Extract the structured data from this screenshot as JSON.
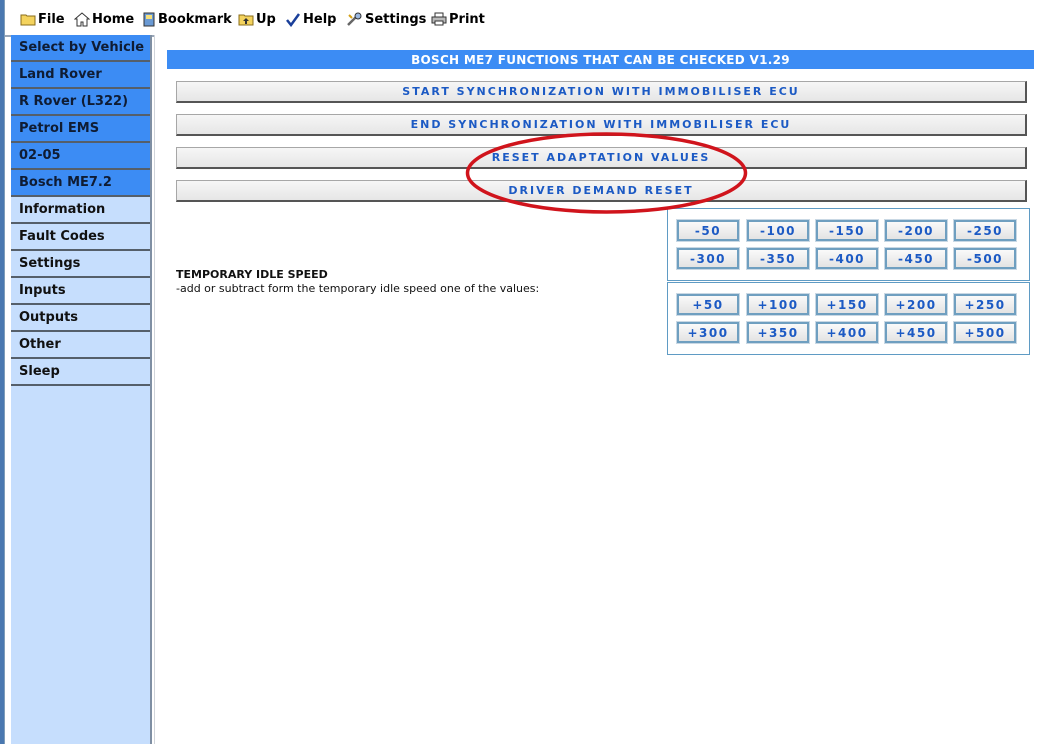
{
  "toolbar": {
    "items": [
      {
        "label": "File",
        "icon": "folder-icon"
      },
      {
        "label": "Home",
        "icon": "home-icon"
      },
      {
        "label": "Bookmark",
        "icon": "bookmark-icon"
      },
      {
        "label": "Up",
        "icon": "up-folder-icon"
      },
      {
        "label": "Help",
        "icon": "help-icon"
      },
      {
        "label": "Settings",
        "icon": "settings-icon"
      },
      {
        "label": "Print",
        "icon": "printer-icon"
      }
    ]
  },
  "sidebar": {
    "items": [
      {
        "label": "Select by Vehicle",
        "style": "blue"
      },
      {
        "label": "Land Rover",
        "style": "blue"
      },
      {
        "label": "R Rover (L322)",
        "style": "blue"
      },
      {
        "label": "Petrol EMS",
        "style": "blue"
      },
      {
        "label": "02-05",
        "style": "blue"
      },
      {
        "label": "Bosch ME7.2",
        "style": "blue"
      },
      {
        "label": "Information",
        "style": "light"
      },
      {
        "label": "Fault Codes",
        "style": "light"
      },
      {
        "label": "Settings",
        "style": "light"
      },
      {
        "label": "Inputs",
        "style": "light"
      },
      {
        "label": "Outputs",
        "style": "light"
      },
      {
        "label": "Other",
        "style": "light"
      },
      {
        "label": "Sleep",
        "style": "light"
      }
    ]
  },
  "main": {
    "banner": "BOSCH ME7 FUNCTIONS THAT CAN BE CHECKED V1.29",
    "functions": [
      "START SYNCHRONIZATION WITH IMMOBILISER ECU",
      "END SYNCHRONIZATION WITH IMMOBILISER ECU",
      "RESET ADAPTATION VALUES",
      "DRIVER DEMAND RESET"
    ],
    "idle": {
      "title": "TEMPORARY IDLE SPEED",
      "description": "-add or subtract form the temporary idle speed one of the values:",
      "minus": [
        "-50",
        "-100",
        "-150",
        "-200",
        "-250",
        "-300",
        "-350",
        "-400",
        "-450",
        "-500"
      ],
      "plus": [
        "+50",
        "+100",
        "+150",
        "+200",
        "+250",
        "+300",
        "+350",
        "+400",
        "+450",
        "+500"
      ]
    }
  },
  "colors": {
    "accent": "#3c8cf4",
    "sidebar_light": "#c6defd",
    "button_text": "#1c5ac4",
    "annotation": "#d0141c"
  }
}
